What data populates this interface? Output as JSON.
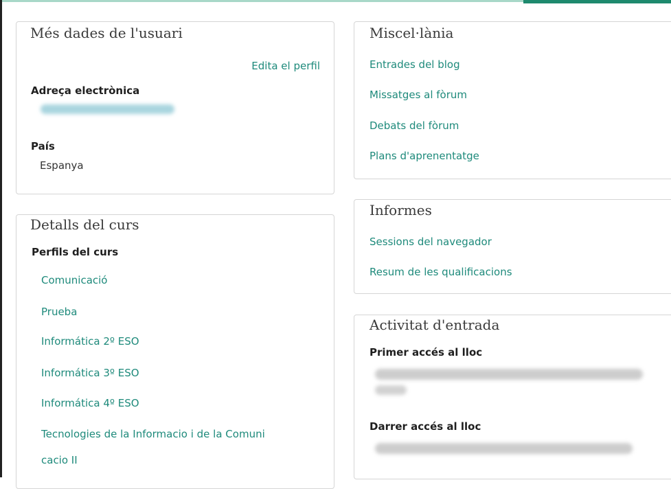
{
  "user_details": {
    "title": "Més dades de l'usuari",
    "edit_link": "Edita el perfil",
    "email_label": "Adreça electrònica",
    "country_label": "País",
    "country_value": "Espanya"
  },
  "course_details": {
    "title": "Detalls del curs",
    "profiles_label": "Perfils del curs",
    "courses": [
      "Comunicació",
      "Prueba",
      "Informática 2º ESO",
      "Informática 3º ESO",
      "Informática 4º ESO",
      "Tecnologies de la Informacio i de la Comuni",
      "cacio II"
    ]
  },
  "misc": {
    "title": "Miscel·lània",
    "links": [
      "Entrades del blog",
      "Missatges al fòrum",
      "Debats del fòrum",
      "Plans d'aprenentatge"
    ]
  },
  "reports": {
    "title": "Informes",
    "links": [
      "Sessions del navegador",
      "Resum de les qualificacions"
    ]
  },
  "login_activity": {
    "title": "Activitat d'entrada",
    "first_access_label": "Primer accés al lloc",
    "last_access_label": "Darrer accés al lloc"
  },
  "colors": {
    "link": "#1e8a7b",
    "accent": "#1e8a6e"
  }
}
